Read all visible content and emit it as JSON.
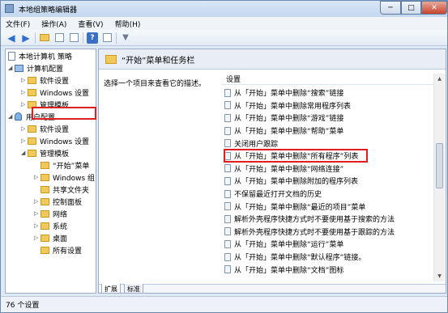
{
  "window": {
    "title": "本地组策略编辑器",
    "controls": {
      "minimize": "─",
      "maximize": "□",
      "close": "✕"
    }
  },
  "menu": [
    "文件(F)",
    "操作(A)",
    "查看(V)",
    "帮助(H)"
  ],
  "tree": [
    {
      "label": "本地计算机 策略",
      "depth": 0,
      "icon": "document-icon"
    },
    {
      "label": "计算机配置",
      "depth": 1,
      "icon": "computer-icon"
    },
    {
      "label": "软件设置",
      "depth": 2,
      "icon": "folder-icon"
    },
    {
      "label": "Windows 设置",
      "depth": 2,
      "icon": "folder-icon"
    },
    {
      "label": "管理模板",
      "depth": 2,
      "icon": "folder-icon"
    },
    {
      "label": "用户配置",
      "depth": 1,
      "icon": "user-icon"
    },
    {
      "label": "软件设置",
      "depth": 2,
      "icon": "folder-icon"
    },
    {
      "label": "Windows 设置",
      "depth": 2,
      "icon": "folder-icon"
    },
    {
      "label": "管理模板",
      "depth": 2,
      "icon": "folder-icon"
    },
    {
      "label": "“开始”菜单",
      "depth": 3,
      "icon": "folder-icon",
      "selected": true
    },
    {
      "label": "Windows 组",
      "depth": 3,
      "icon": "folder-icon"
    },
    {
      "label": "共享文件夹",
      "depth": 3,
      "icon": "folder-icon"
    },
    {
      "label": "控制面板",
      "depth": 3,
      "icon": "folder-icon"
    },
    {
      "label": "网络",
      "depth": 3,
      "icon": "folder-icon"
    },
    {
      "label": "系统",
      "depth": 3,
      "icon": "folder-icon"
    },
    {
      "label": "桌面",
      "depth": 3,
      "icon": "folder-icon"
    },
    {
      "label": "所有设置",
      "depth": 3,
      "icon": "folder-icon"
    }
  ],
  "panel": {
    "header": "“开始”菜单和任务栏",
    "description": "选择一个项目来查看它的描述。",
    "column": "设置",
    "settings": [
      "从「开始」菜单中删除“搜索”链接",
      "从「开始」菜单中删除常用程序列表",
      "从「开始」菜单中删除“游戏”链接",
      "从「开始」菜单中删除“帮助”菜单",
      "关闭用户跟踪",
      "从「开始」菜单中删除“所有程序”列表",
      "从「开始」菜单中删除“网络连接”",
      "从「开始」菜单中删除附加的程序列表",
      "不保留最近打开文档的历史",
      "从「开始」菜单中删除“最近的项目”菜单",
      "解析外壳程序快捷方式时不要使用基于搜索的方法",
      "解析外壳程序快捷方式时不要使用基于跟踪的方法",
      "从「开始」菜单中删除“运行”菜单",
      "从「开始」菜单中删除“默认程序”链接。",
      "从「开始」菜单中删除“文档”图标"
    ],
    "tabs": [
      "扩展",
      "标准"
    ]
  },
  "status": "76 个设置",
  "colors": {
    "highlight": "#e02020",
    "frame": "#6d8bb3"
  }
}
